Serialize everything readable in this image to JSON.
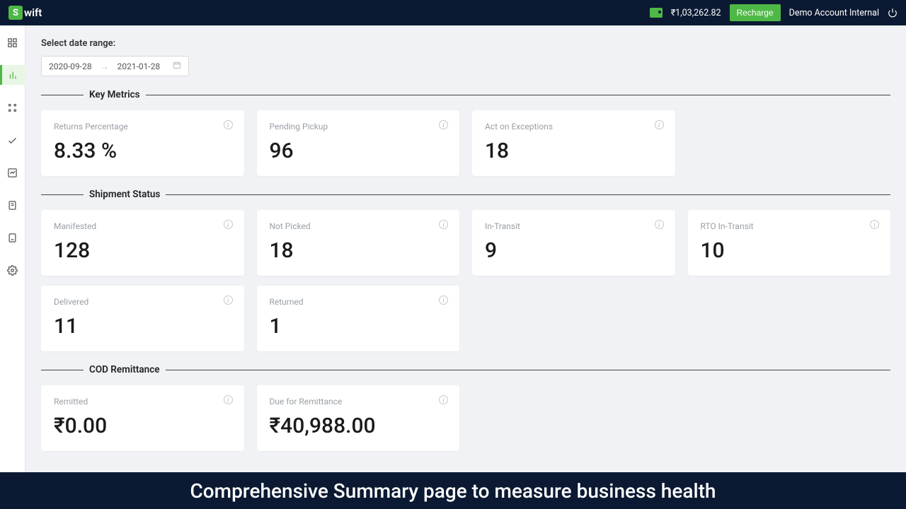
{
  "header": {
    "logo_letter": "S",
    "logo_text": "wift",
    "balance": "₹1,03,262.82",
    "recharge_label": "Recharge",
    "account_label": "Demo Account Internal"
  },
  "date_section": {
    "label": "Select date range:",
    "start": "2020-09-28",
    "end": "2021-01-28"
  },
  "sections": {
    "key_metrics": {
      "title": "Key Metrics",
      "cards": [
        {
          "label": "Returns Percentage",
          "value": "8.33 %"
        },
        {
          "label": "Pending Pickup",
          "value": "96"
        },
        {
          "label": "Act on Exceptions",
          "value": "18"
        }
      ]
    },
    "shipment_status": {
      "title": "Shipment Status",
      "cards": [
        {
          "label": "Manifested",
          "value": "128"
        },
        {
          "label": "Not Picked",
          "value": "18"
        },
        {
          "label": "In-Transit",
          "value": "9"
        },
        {
          "label": "RTO In-Transit",
          "value": "10"
        },
        {
          "label": "Delivered",
          "value": "11"
        },
        {
          "label": "Returned",
          "value": "1"
        }
      ]
    },
    "cod": {
      "title": "COD Remittance",
      "cards": [
        {
          "label": "Remitted",
          "value": "₹0.00"
        },
        {
          "label": "Due for Remittance",
          "value": "₹40,988.00"
        }
      ]
    }
  },
  "caption": "Comprehensive Summary page to measure business health"
}
